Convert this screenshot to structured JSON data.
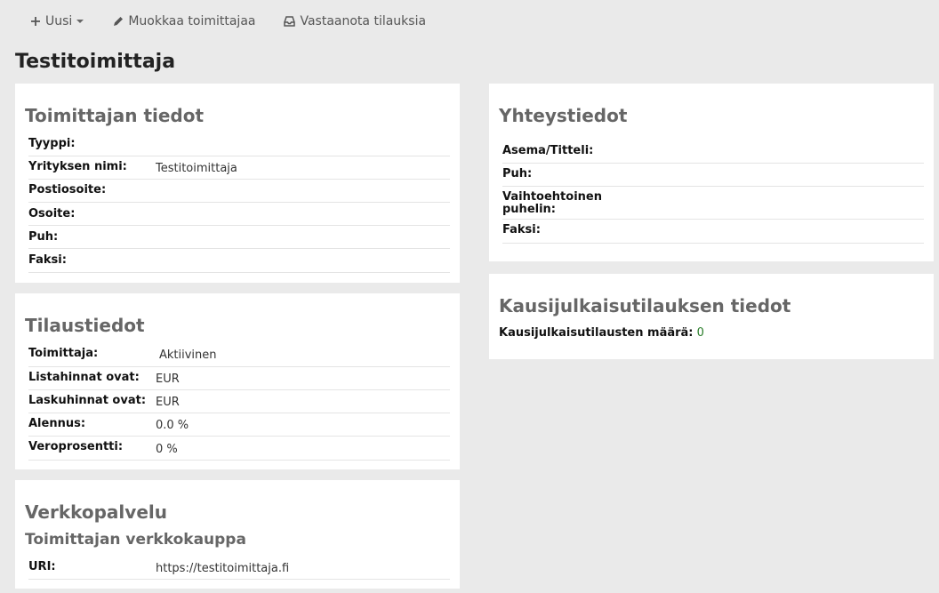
{
  "toolbar": {
    "new_label": "Uusi",
    "edit_label": "Muokkaa toimittajaa",
    "receive_label": "Vastaanota tilauksia"
  },
  "page_title": "Testitoimittaja",
  "vendor_details": {
    "title": "Toimittajan tiedot",
    "rows": [
      {
        "label": "Tyyppi:",
        "value": ""
      },
      {
        "label": "Yrityksen nimi:",
        "value": "Testitoimittaja"
      },
      {
        "label": "Postiosoite:",
        "value": ""
      },
      {
        "label": "Osoite:",
        "value": ""
      },
      {
        "label": "Puh:",
        "value": ""
      },
      {
        "label": "Faksi:",
        "value": ""
      }
    ]
  },
  "ordering": {
    "title": "Tilaustiedot",
    "rows": [
      {
        "label": "Toimittaja:",
        "value": "Aktiivinen"
      },
      {
        "label": "Listahinnat ovat:",
        "value": "EUR"
      },
      {
        "label": "Laskuhinnat ovat:",
        "value": "EUR"
      },
      {
        "label": "Alennus:",
        "value": "0.0 %"
      },
      {
        "label": "Veroprosentti:",
        "value": "0 %"
      }
    ]
  },
  "web": {
    "title": "Verkkopalvelu",
    "subtitle": "Toimittajan verkkokauppa",
    "uri_label": "URI:",
    "uri_value": "https://testitoimittaja.fi"
  },
  "contact": {
    "title": "Yhteystiedot",
    "rows": [
      {
        "label": "Asema/Titteli:",
        "value": ""
      },
      {
        "label": "Puh:",
        "value": ""
      },
      {
        "label": "Vaihtoehtoinen puhelin:",
        "value": ""
      },
      {
        "label": "Faksi:",
        "value": ""
      }
    ]
  },
  "subscriptions": {
    "title": "Kausijulkaisutilauksen tiedot",
    "count_label": "Kausijulkaisutilausten määrä:",
    "count_value": "0"
  }
}
